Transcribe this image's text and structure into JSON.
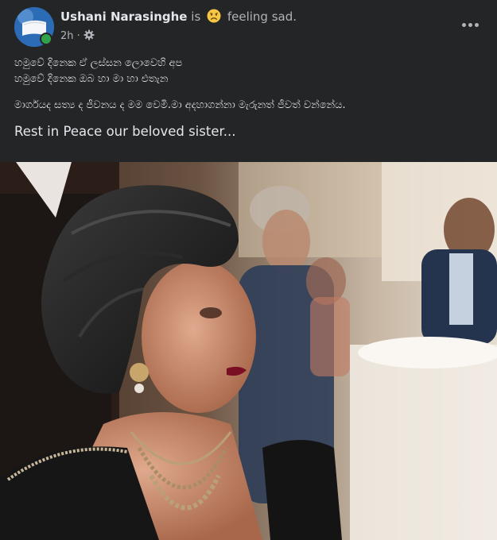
{
  "post": {
    "author": "Ushani Narasinghe",
    "is_text": "is",
    "feeling_text": "feeling sad.",
    "time": "2h",
    "body_lines": [
      "හමුවේ දිනෙක ඒ ලස්සන ලොවෙහි අප",
      "හමුවේ දිනෙක ඔබ හා මා හා එතැන",
      "මාර්ගයද සත්‍ය ද ජීවනය ද මම වෙමි.මා අදහාගන්නා මැරුනත් ජීවත් වන්නේය."
    ],
    "caption": "Rest in Peace our beloved sister..."
  },
  "icons": {
    "feeling": "sad-face-emoji-icon",
    "audience": "settings-gear-icon",
    "more": "more-options-icon"
  },
  "colors": {
    "background": "#242526",
    "text": "#e4e6eb",
    "muted": "#b0b3b8",
    "online": "#31a24c"
  }
}
